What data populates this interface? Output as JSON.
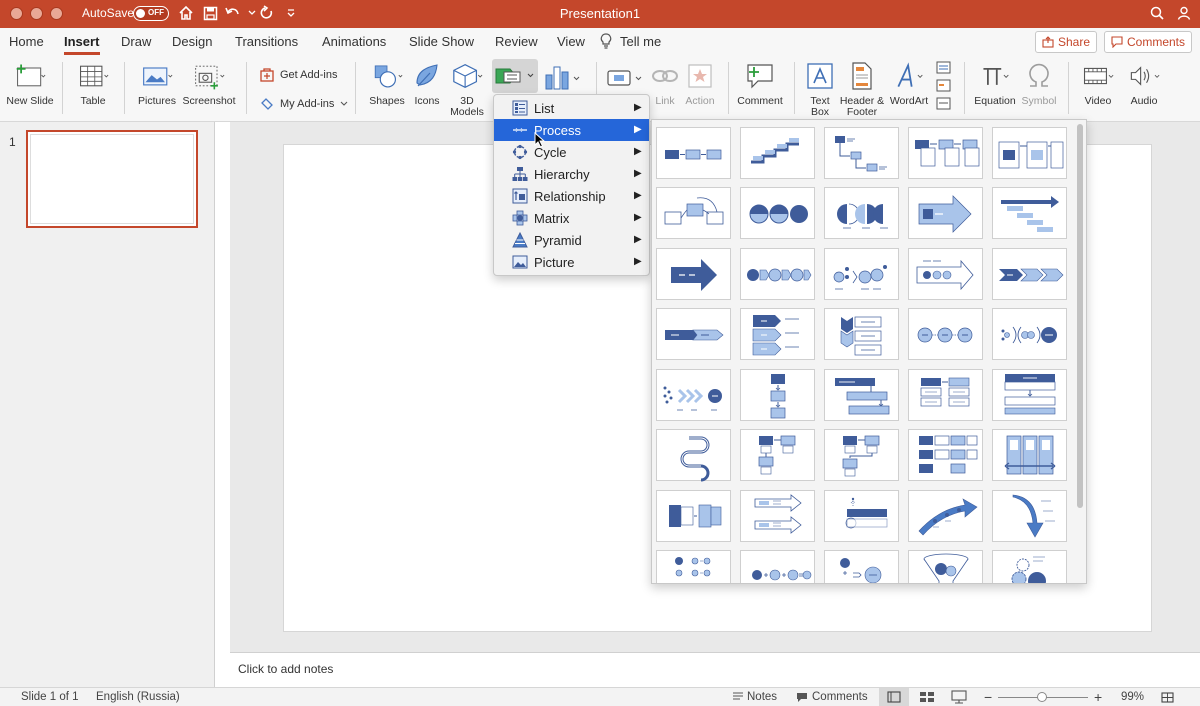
{
  "titlebar": {
    "autosave_label": "AutoSave",
    "autosave_state": "OFF",
    "document_title": "Presentation1"
  },
  "tabs": [
    "Home",
    "Insert",
    "Draw",
    "Design",
    "Transitions",
    "Animations",
    "Slide Show",
    "Review",
    "View"
  ],
  "active_tab": "Insert",
  "tell_me": "Tell me",
  "share_label": "Share",
  "comments_label": "Comments",
  "ribbon": {
    "new_slide": "New Slide",
    "table": "Table",
    "pictures": "Pictures",
    "screenshot": "Screenshot",
    "get_addins": "Get Add-ins",
    "my_addins": "My Add-ins",
    "shapes": "Shapes",
    "icons": "Icons",
    "models_3d": "3D Models",
    "link": "Link",
    "action": "Action",
    "comment": "Comment",
    "text_box": "Text Box",
    "header_footer": "Header & Footer",
    "wordart": "WordArt",
    "equation": "Equation",
    "symbol": "Symbol",
    "video": "Video",
    "audio": "Audio"
  },
  "slides_pane": {
    "slide_number": "1"
  },
  "notes_placeholder": "Click to add notes",
  "smartart_menu": {
    "items": [
      "List",
      "Process",
      "Cycle",
      "Hierarchy",
      "Relationship",
      "Matrix",
      "Pyramid",
      "Picture"
    ],
    "active": "Process"
  },
  "status": {
    "slide": "Slide 1 of 1",
    "language": "English (Russia)",
    "notes": "Notes",
    "comments": "Comments",
    "zoom": "99%"
  },
  "colors": {
    "accent": "#c4472b",
    "selection": "#2566d9",
    "smartart_dark": "#3f5c9a",
    "smartart_light": "#a9c4ea"
  }
}
